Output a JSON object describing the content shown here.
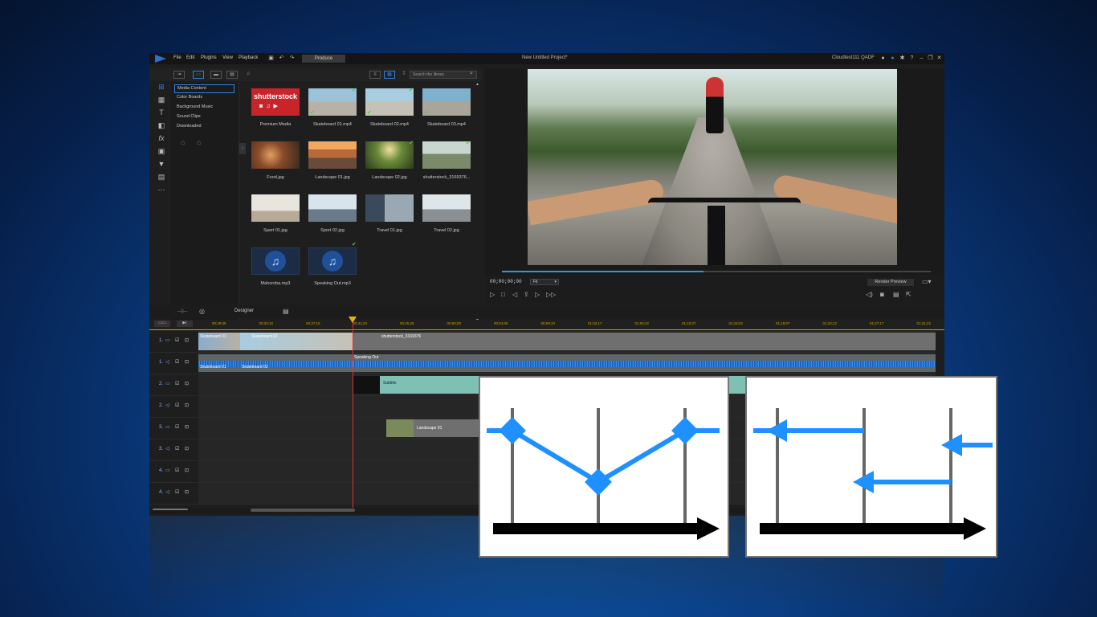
{
  "menu": {
    "items": [
      "File",
      "Edit",
      "Plugins",
      "View",
      "Playback"
    ],
    "produce_label": "Produce",
    "project_title": "New Untitled Project*",
    "user_label": "Cloudtest111 QADF"
  },
  "library": {
    "search_placeholder": "Search the library",
    "tree": [
      "Media Content",
      "Color Boards",
      "Background Music",
      "Sound Clips",
      "Downloaded"
    ],
    "items": [
      {
        "label": "Premium Media",
        "kind": "shutterstock"
      },
      {
        "label": "Skateboard 01.mp4",
        "kind": "video"
      },
      {
        "label": "Skateboard 02.mp4",
        "kind": "video"
      },
      {
        "label": "Skateboard 03.mp4",
        "kind": "video"
      },
      {
        "label": "Food.jpg",
        "kind": "image"
      },
      {
        "label": "Landscape 01.jpg",
        "kind": "image"
      },
      {
        "label": "Landscape 02.jpg",
        "kind": "image"
      },
      {
        "label": "shutterstock_3169376...",
        "kind": "image"
      },
      {
        "label": "Sport 01.jpg",
        "kind": "image"
      },
      {
        "label": "Sport 02.jpg",
        "kind": "image"
      },
      {
        "label": "Travel 01.jpg",
        "kind": "image"
      },
      {
        "label": "Travel 02.jpg",
        "kind": "image"
      },
      {
        "label": "Mahoroba.mp3",
        "kind": "audio"
      },
      {
        "label": "Speaking Out.mp3",
        "kind": "audio"
      }
    ],
    "shutterstock_logo": "shutterstock"
  },
  "preview": {
    "timecode": "00;00;00;00",
    "fit_label": "Fit",
    "render_label": "Render Preview",
    "progress": 0.47
  },
  "timeline": {
    "designer_label": "Designer",
    "ruler": [
      "00;29;05",
      "00;33;10",
      "00;37;15",
      "00;41;20",
      "00;45;25",
      "00;50;00",
      "00;54;05",
      "00;58;10",
      "01;02;17",
      "01;06;22",
      "01;10;27",
      "01;15;02",
      "01;19;07",
      "01;23;12",
      "01;27;17",
      "01;31;22"
    ],
    "tracks": [
      "1.",
      "1.",
      "2.",
      "2.",
      "3.",
      "3.",
      "4.",
      "4."
    ],
    "clips": {
      "skate1": "Skateboard 01",
      "skate2": "Skateboard 02",
      "speaking": "Speaking Out",
      "shutterstock": "shutterstock_3169376",
      "subtitle": "Subtitle",
      "landscape": "Landscape 01"
    }
  },
  "colors": {
    "accent": "#2f7fe0",
    "diagram_blue": "#1e90ff",
    "ruler": "#c8a000"
  }
}
